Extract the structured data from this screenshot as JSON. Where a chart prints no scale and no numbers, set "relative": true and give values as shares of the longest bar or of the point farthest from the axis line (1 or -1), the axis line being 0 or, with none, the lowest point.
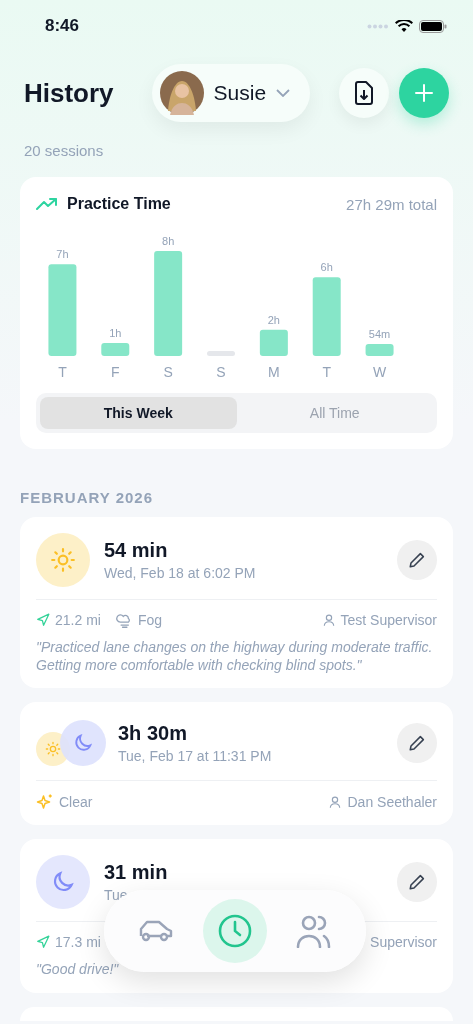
{
  "status_bar": {
    "time": "8:46"
  },
  "header": {
    "title": "History",
    "profile": {
      "name": "Susie"
    },
    "subtitle": "20 sessions"
  },
  "practice_card": {
    "title": "Practice Time",
    "total": "27h 29m total",
    "chart_data": {
      "type": "bar",
      "categories": [
        "T",
        "F",
        "S",
        "S",
        "M",
        "T",
        "W"
      ],
      "values": [
        0.875,
        0.125,
        1,
        0,
        0.25,
        0.75,
        0.1125
      ],
      "relative": true
    },
    "bar_labels": [
      {
        "kind": "value",
        "text": "7h"
      },
      {
        "kind": "value",
        "text": "1h"
      },
      {
        "kind": "value",
        "text": "8h"
      },
      {
        "kind": "empty"
      },
      {
        "kind": "value",
        "text": "2h"
      },
      {
        "kind": "value",
        "text": "6h"
      },
      {
        "kind": "value",
        "text": "54m"
      }
    ],
    "segments": [
      {
        "label": "This Week",
        "selected": true
      },
      {
        "label": "All Time",
        "selected": false
      }
    ]
  },
  "section_heading": "FEBRUARY 2026",
  "sessions": [
    {
      "kind": "day",
      "duration": "54 min",
      "date": "Wed, Feb 18 at 6:02 PM",
      "distance": "21.2 mi",
      "weather": {
        "kind": "fog",
        "label": "Fog"
      },
      "supervisor": "Test Supervisor",
      "note": "\"Practiced lane changes on the highway during moderate traffic. Getting more comfortable with checking blind spots.\""
    },
    {
      "kind": "dusk",
      "duration": "3h 30m",
      "date": "Tue, Feb 17 at 11:31 PM",
      "weather": {
        "kind": "clear",
        "label": "Clear"
      },
      "supervisor": "Dan Seethaler"
    },
    {
      "kind": "night",
      "duration": "31 min",
      "date": "Tue",
      "distance": "17.3 mi",
      "supervisor": "Supervisor",
      "note": "\"Good drive!\""
    },
    {
      "kind": "blank"
    }
  ],
  "tab_bar": [
    {
      "kind": "car",
      "selected": false
    },
    {
      "kind": "clock",
      "selected": true
    },
    {
      "kind": "people",
      "selected": false
    }
  ]
}
